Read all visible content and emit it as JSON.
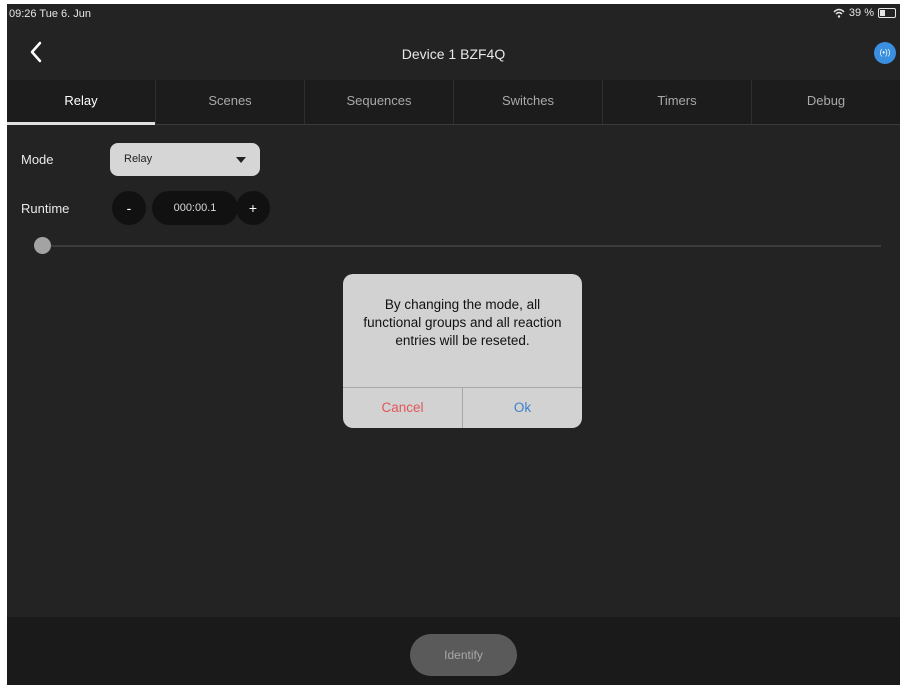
{
  "status_bar": {
    "time": "09:26",
    "date": "Tue 6. Jun",
    "wifi_icon": "wifi-icon",
    "battery": "39 %",
    "battery_level": 0.39
  },
  "nav": {
    "back_icon": "chevron-left-icon",
    "title": "Device 1 BZF4Q",
    "signal_icon": "(•))"
  },
  "tabs": [
    {
      "label": "Relay",
      "active": true
    },
    {
      "label": "Scenes",
      "active": false
    },
    {
      "label": "Sequences",
      "active": false
    },
    {
      "label": "Switches",
      "active": false
    },
    {
      "label": "Timers",
      "active": false
    },
    {
      "label": "Debug",
      "active": false
    }
  ],
  "mode": {
    "label": "Mode",
    "selected": "Relay"
  },
  "runtime": {
    "label": "Runtime",
    "decrement": "-",
    "value": "000:00.1",
    "increment": "+"
  },
  "slider": {
    "level": 0.0
  },
  "dialog": {
    "message": "By changing the mode, all functional groups and all reaction entries will be reseted.",
    "cancel_label": "Cancel",
    "ok_label": "Ok"
  },
  "bottom": {
    "identify_label": "Identify"
  },
  "colors": {
    "background": "#232323",
    "accent_blue": "#3b8fe0",
    "cancel_red": "#e0565b",
    "ok_blue": "#3b82cc"
  }
}
